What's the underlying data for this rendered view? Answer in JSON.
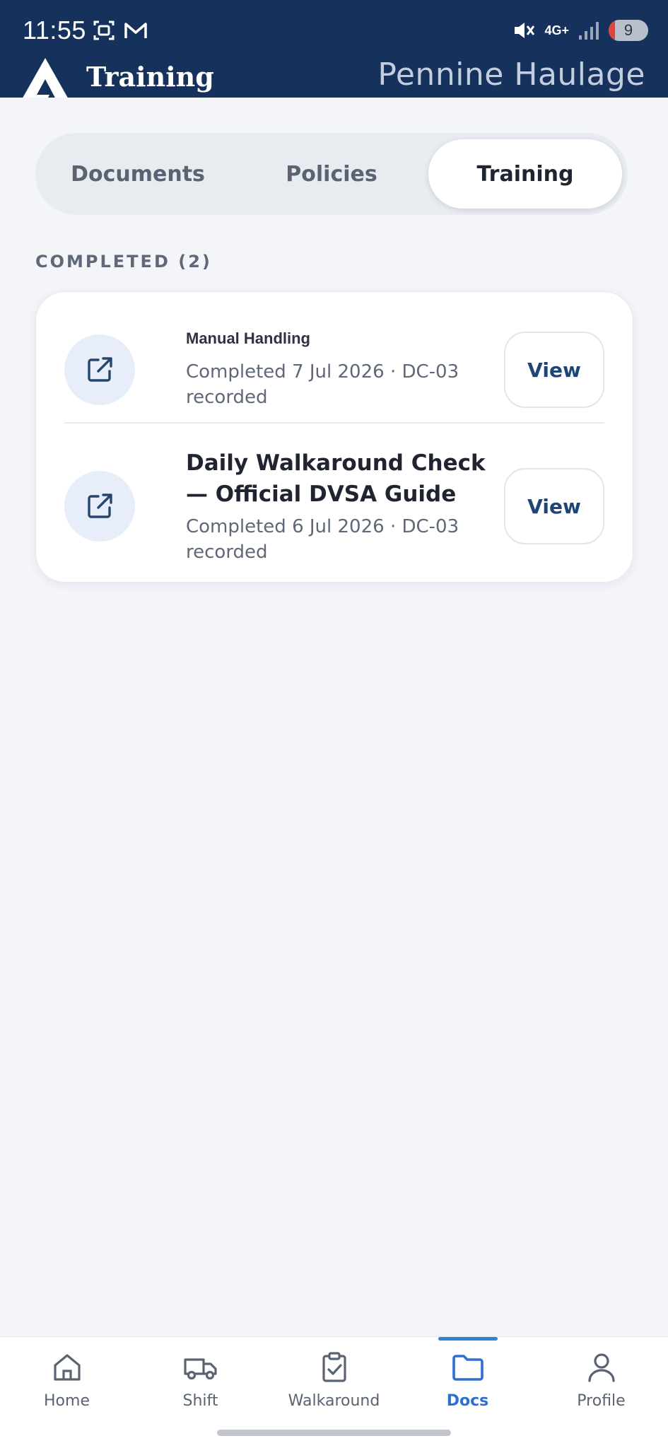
{
  "status_bar": {
    "time": "11:55",
    "network": "4G+",
    "battery": "9"
  },
  "header": {
    "title": "Training",
    "company": "Pennine Haulage"
  },
  "tabs": [
    {
      "label": "Documents",
      "active": false
    },
    {
      "label": "Policies",
      "active": false
    },
    {
      "label": "Training",
      "active": true
    }
  ],
  "section": {
    "label": "COMPLETED (2)"
  },
  "items": [
    {
      "title": "Manual Handling",
      "subtitle": "Completed 7 Jul 2026 · DC-03 recorded",
      "button": "View",
      "icon": "external-link-icon"
    },
    {
      "title": "Daily Walkaround Check — Official DVSA Guide",
      "subtitle": "Completed 6 Jul 2026 · DC-03 recorded",
      "button": "View",
      "icon": "external-link-icon"
    }
  ],
  "bottom_nav": [
    {
      "label": "Home",
      "icon": "home-icon",
      "active": false
    },
    {
      "label": "Shift",
      "icon": "truck-icon",
      "active": false
    },
    {
      "label": "Walkaround",
      "icon": "clipboard-check-icon",
      "active": false
    },
    {
      "label": "Docs",
      "icon": "folder-icon",
      "active": true
    },
    {
      "label": "Profile",
      "icon": "user-icon",
      "active": false
    }
  ],
  "colors": {
    "header_bg": "#16325c",
    "accent": "#2f6fd1",
    "page_bg": "#f3f5f9"
  }
}
